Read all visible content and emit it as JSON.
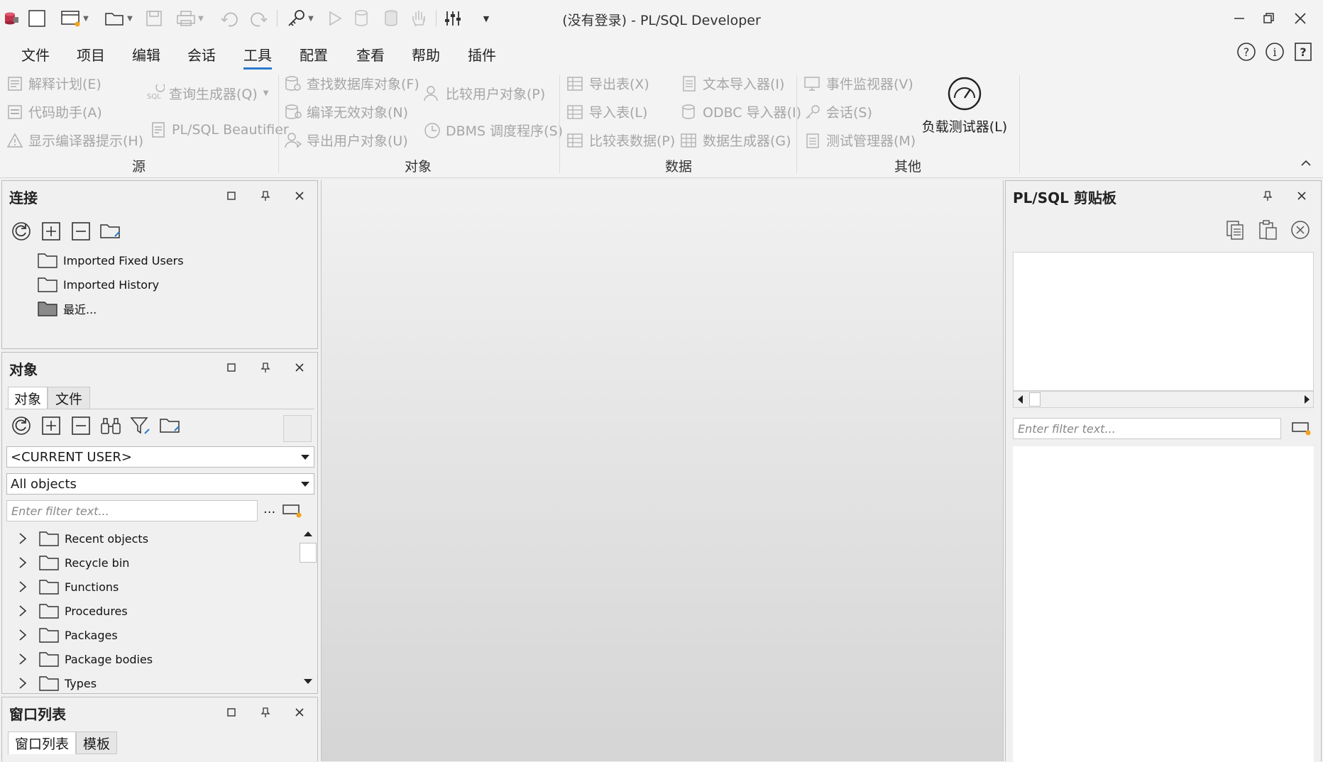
{
  "window": {
    "title": "(没有登录)  - PL/SQL Developer"
  },
  "menu": {
    "items": [
      "文件",
      "项目",
      "编辑",
      "会话",
      "工具",
      "配置",
      "查看",
      "帮助",
      "插件"
    ],
    "active": "工具"
  },
  "ribbon": {
    "groups": [
      {
        "label": "源",
        "items": [
          "解释计划(E)",
          "代码助手(A)",
          "显示编译器提示(H)",
          "查询生成器(Q)",
          "PL/SQL Beautifier"
        ]
      },
      {
        "label": "对象",
        "items": [
          "查找数据库对象(F)",
          "编译无效对象(N)",
          "导出用户对象(U)",
          "比较用户对象(P)",
          "DBMS 调度程序(S)"
        ]
      },
      {
        "label": "数据",
        "items": [
          "导出表(X)",
          "导入表(L)",
          "比较表数据(P)",
          "文本导入器(I)",
          "ODBC 导入器(I)",
          "数据生成器(G)"
        ]
      },
      {
        "label": "其他",
        "items": [
          "事件监视器(V)",
          "会话(S)",
          "测试管理器(M)",
          "负载测试器(L)"
        ]
      }
    ]
  },
  "connections": {
    "title": "连接",
    "items": [
      "Imported Fixed Users",
      "Imported History",
      "最近..."
    ]
  },
  "objects": {
    "title": "对象",
    "tabs": [
      "对象",
      "文件"
    ],
    "user_select": "<CURRENT USER>",
    "type_select": "All objects",
    "filter_placeholder": "Enter filter text...",
    "ellipsis": "...",
    "tree": [
      "Recent objects",
      "Recycle bin",
      "Functions",
      "Procedures",
      "Packages",
      "Package bodies",
      "Types"
    ]
  },
  "window_list": {
    "title": "窗口列表",
    "tabs": [
      "窗口列表",
      "模板"
    ]
  },
  "clipboard": {
    "title": "PL/SQL 剪贴板",
    "filter_placeholder": "Enter filter text..."
  }
}
